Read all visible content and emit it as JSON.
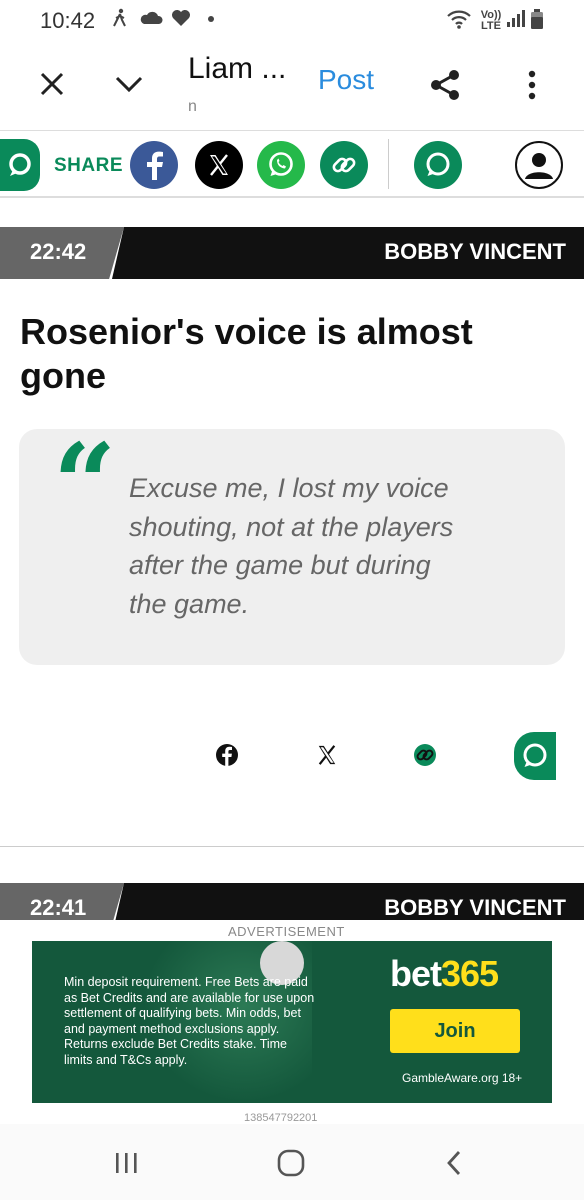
{
  "status_bar": {
    "time": "10:42",
    "icons": [
      "walking-icon",
      "cloud-icon",
      "heart-icon",
      "dot-icon",
      "wifi-calling-icon",
      "volte-icon",
      "signal-icon",
      "battery-icon"
    ],
    "volte_label": "Vo)) LTE"
  },
  "top_bar": {
    "title": "Liam ...",
    "subtitle": "n",
    "post_label": "Post"
  },
  "share_bar": {
    "share_label": "SHARE"
  },
  "entries": [
    {
      "time": "22:42",
      "author": "BOBBY VINCENT",
      "headline": "Rosenior's voice is almost gone",
      "quote": "Excuse me, I lost my voice shouting, not at the players after the game but during the game."
    },
    {
      "time": "22:41",
      "author": "BOBBY VINCENT"
    }
  ],
  "advertisement": {
    "label": "ADVERTISEMENT",
    "text": "Min deposit requirement. Free Bets are paid as Bet Credits and are available for use upon settlement of qualifying bets. Min odds, bet and payment method exclusions apply. Returns exclude Bet Credits stake. Time limits and T&Cs apply.",
    "brand_a": "bet",
    "brand_b": "365",
    "join_label": "Join",
    "gamble_aware": "GambleAware.org  18+",
    "ad_id": "138547792201"
  },
  "colors": {
    "accent_green": "#0a8a5a",
    "post_blue": "#2a8cde",
    "ad_bg": "#14583c",
    "ad_yellow": "#ffdf1b"
  }
}
